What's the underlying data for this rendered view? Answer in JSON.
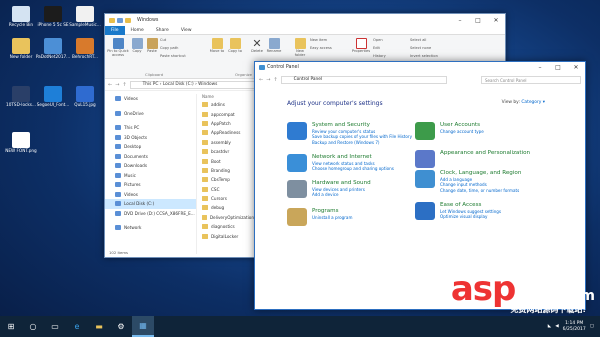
{
  "desktop": {
    "icons": [
      {
        "label": "Recycle Bin",
        "color": "#d4e3f2"
      },
      {
        "label": "iPhone 5 5c SE",
        "color": "#1c1c1c"
      },
      {
        "label": "SampleMusic...",
        "color": "#f1f1f1"
      },
      {
        "label": "New folder",
        "color": "#e9c35c"
      },
      {
        "label": "PaDotNet2017...",
        "color": "#4c8fd6"
      },
      {
        "label": "BehrochRT...",
        "color": "#d87a2c"
      },
      {
        "label": "10TSD-locks...",
        "color": "#2a3f68"
      },
      {
        "label": "SegoeUI_Font...",
        "color": "#1e7fd8"
      },
      {
        "label": "QuL15.jpg",
        "color": "#2f6bd0"
      },
      {
        "label": "NEW FONT.png",
        "color": "#ffffff"
      }
    ]
  },
  "explorer": {
    "title": "Windows",
    "tabs": [
      "File",
      "Home",
      "Share",
      "View"
    ],
    "ribbon": {
      "pin": "Pin to Quick access",
      "copy": "Copy",
      "paste": "Paste",
      "cut": "Cut",
      "copy_path": "Copy path",
      "paste_shortcut": "Paste shortcut",
      "move_to": "Move to",
      "copy_to": "Copy to",
      "delete": "Delete",
      "rename": "Rename",
      "new_folder": "New folder",
      "new_item": "New item",
      "easy_access": "Easy access",
      "properties": "Properties",
      "open": "Open",
      "edit": "Edit",
      "history": "History",
      "select_all": "Select all",
      "select_none": "Select none",
      "invert": "Invert selection",
      "clipboard": "Clipboard",
      "organize": "Organize",
      "new": "New",
      "open_grp": "Open",
      "select": "Select"
    },
    "address": [
      "This PC",
      "Local Disk (C:)",
      "Windows"
    ],
    "nav": [
      "Videos",
      "OneDrive",
      "This PC",
      "3D Objects",
      "Desktop",
      "Documents",
      "Downloads",
      "Music",
      "Pictures",
      "Videos",
      "Local Disk (C:)",
      "DVD Drive (D:) CCSA_X86FRE_E...",
      "Network"
    ],
    "files_header": "Name",
    "files": [
      "addins",
      "appcompat",
      "AppPatch",
      "AppReadiness",
      "assembly",
      "bcastdvr",
      "Boot",
      "Branding",
      "CbsTemp",
      "CSC",
      "Cursors",
      "debug",
      "DeliveryOptimization",
      "diagnostics",
      "DigitalLocker"
    ],
    "status": "102 items"
  },
  "cpanel": {
    "title": "Control Panel",
    "address": "Control Panel",
    "search": "Search Control Panel",
    "heading": "Adjust your computer's settings",
    "view_by_label": "View by:",
    "view_by_value": "Category ▾",
    "left": [
      {
        "title": "System and Security",
        "links": [
          "Review your computer's status",
          "Save backup copies of your files with File History",
          "Backup and Restore (Windows 7)"
        ],
        "color": "#2f7bd1"
      },
      {
        "title": "Network and Internet",
        "links": [
          "View network status and tasks",
          "Choose homegroup and sharing options"
        ],
        "color": "#3a8fd8"
      },
      {
        "title": "Hardware and Sound",
        "links": [
          "View devices and printers",
          "Add a device"
        ],
        "color": "#7e8fa0"
      },
      {
        "title": "Programs",
        "links": [
          "Uninstall a program"
        ],
        "color": "#c9a65a"
      }
    ],
    "right": [
      {
        "title": "User Accounts",
        "links": [
          "Change account type"
        ],
        "color": "#3d9b4a"
      },
      {
        "title": "Appearance and Personalization",
        "links": [],
        "color": "#5b78c9"
      },
      {
        "title": "Clock, Language, and Region",
        "links": [
          "Add a language",
          "Change input methods",
          "Change date, time, or number formats"
        ],
        "color": "#3f8fd1"
      },
      {
        "title": "Ease of Access",
        "links": [
          "Let Windows suggest settings",
          "Optimize visual display"
        ],
        "color": "#2c6fc4"
      }
    ]
  },
  "taskbar": {
    "time": "1:14 PM",
    "date": "6/25/2017"
  },
  "watermark": {
    "main": "asp",
    "ku": "ku",
    "suffix": ".com",
    "sub": "免费网站源码下载站!"
  }
}
